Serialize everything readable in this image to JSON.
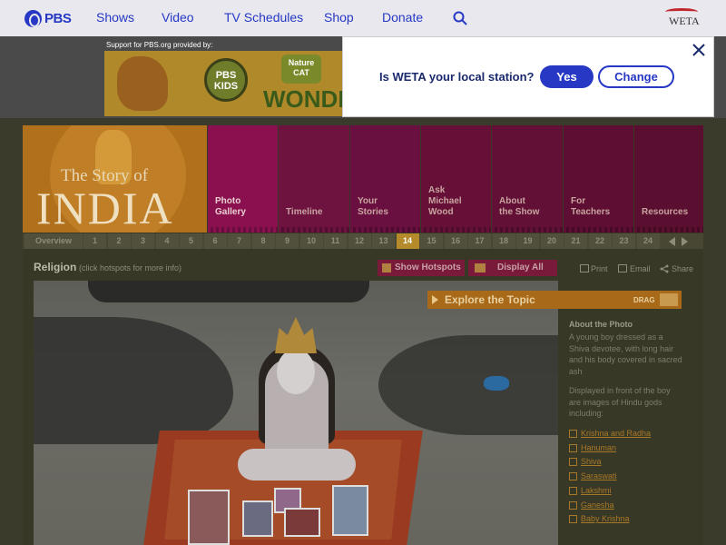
{
  "topnav": {
    "logo_text": "PBS",
    "links": [
      "Shows",
      "Video",
      "TV Schedules",
      "Shop",
      "Donate"
    ],
    "station_logo": "WETA"
  },
  "ad": {
    "support_text": "Support for PBS.org provided by:",
    "pbs_kids": "PBS KIDS",
    "nature_cat": "Nature CAT",
    "wonder": "WONDER"
  },
  "station_popup": {
    "question": "Is WETA your local station?",
    "yes_label": "Yes",
    "change_label": "Change"
  },
  "header": {
    "story_of": "The Story of",
    "india": "INDIA",
    "sections": [
      {
        "label_1": "Photo",
        "label_2": "Gallery",
        "label_3": "",
        "color": "#8a1050"
      },
      {
        "label_1": "",
        "label_2": "Timeline",
        "label_3": "",
        "color": "#6e1240"
      },
      {
        "label_1": "Your",
        "label_2": "Stories",
        "label_3": "",
        "color": "#6a1040"
      },
      {
        "label_1": "Ask",
        "label_2": "Michael",
        "label_3": "Wood",
        "color": "#661038"
      },
      {
        "label_1": "About",
        "label_2": "the Show",
        "label_3": "",
        "color": "#621036"
      },
      {
        "label_1": "For",
        "label_2": "Teachers",
        "label_3": "",
        "color": "#5e0e32"
      },
      {
        "label_1": "",
        "label_2": "Resources",
        "label_3": "",
        "color": "#5a0e30"
      }
    ]
  },
  "numbers": {
    "overview": "Overview",
    "items": [
      "1",
      "2",
      "3",
      "4",
      "5",
      "6",
      "7",
      "8",
      "9",
      "10",
      "11",
      "12",
      "13",
      "14",
      "15",
      "16",
      "17",
      "18",
      "19",
      "20",
      "21",
      "22",
      "23",
      "24"
    ],
    "active": "14"
  },
  "toolbar": {
    "title": "Religion",
    "hint": "(click hotspots for more info)",
    "hotspots_label": "Show Hotspots",
    "display_label": "Display All",
    "print_label": "Print",
    "email_label": "Email",
    "share_label": "Share"
  },
  "explore": {
    "title": "Explore the Topic",
    "drag_label": "DRAG"
  },
  "about": {
    "title": "About the Photo",
    "description": "A young boy dressed as a Shiva devotee, with long hair and his body covered in sacred ash",
    "gods_intro": "Displayed in front of the boy are images of Hindu gods including:",
    "gods": [
      "Krishna and Radha",
      "Hanuman",
      "Shiva",
      "Saraswati",
      "Lakshmi",
      "Ganesha",
      "Baby Krishna"
    ]
  }
}
